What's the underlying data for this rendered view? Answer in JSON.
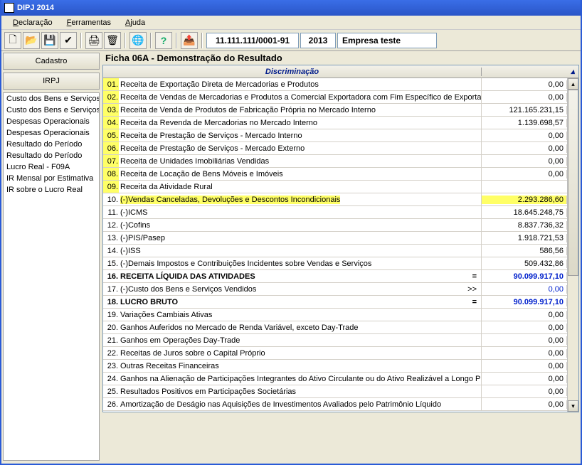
{
  "window": {
    "title": "DIPJ 2014"
  },
  "menu": {
    "declaracao": "Declaração",
    "ferramentas": "Ferramentas",
    "ajuda": "Ajuda"
  },
  "toolbar": {
    "icons": {
      "new": "new-icon",
      "open": "open-icon",
      "save": "save-icon",
      "check": "check-icon",
      "print": "print-icon",
      "trash": "trash-icon",
      "globe": "globe-icon",
      "help": "help-icon",
      "transmit": "transmit-icon"
    },
    "cnpj": "11.111.111/0001-91",
    "year": "2013",
    "company": "Empresa teste"
  },
  "sidebar": {
    "btn_cadastro": "Cadastro",
    "btn_irpj": "IRPJ",
    "items": [
      "Custo dos Bens e Serviços",
      "Custo dos Bens e Serviços",
      "Despesas Operacionais",
      "Despesas Operacionais",
      "Resultado do Período",
      "Resultado do Período",
      "Lucro Real - F09A",
      "IR Mensal por Estimativa",
      "IR sobre o Lucro Real"
    ]
  },
  "ficha": {
    "title": "Ficha 06A - Demonstração do Resultado",
    "header_col": "Discriminação",
    "rows": [
      {
        "num": "01.",
        "desc": "Receita de Exportação Direta de Mercadorias e Produtos",
        "val": "0,00",
        "hl": true
      },
      {
        "num": "02.",
        "desc": "Receita de Vendas de Mercadorias e Produtos a Comercial Exportadora com Fim Específico de Exportação",
        "val": "0,00",
        "hl": true
      },
      {
        "num": "03.",
        "desc": "Receita de Venda de Produtos de Fabricação Própria no Mercado Interno",
        "val": "121.165.231,15",
        "hl": true
      },
      {
        "num": "04.",
        "desc": "Receita da Revenda de Mercadorias no Mercado Interno",
        "val": "1.139.698,57",
        "hl": true
      },
      {
        "num": "05.",
        "desc": "Receita de Prestação de Serviços - Mercado Interno",
        "val": "0,00",
        "hl": true
      },
      {
        "num": "06.",
        "desc": "Receita de Prestação de Serviços - Mercado Externo",
        "val": "0,00",
        "hl": true
      },
      {
        "num": "07.",
        "desc": "Receita de Unidades Imobiliárias Vendidas",
        "val": "0,00",
        "hl": true
      },
      {
        "num": "08.",
        "desc": "Receita de Locação de Bens Móveis e Imóveis",
        "val": "0,00",
        "hl": true
      },
      {
        "num": "09.",
        "desc": "Receita da Atividade Rural",
        "val": "",
        "hl": true
      },
      {
        "num": "10.",
        "desc": "(-)Vendas Canceladas, Devoluções e Descontos Incondicionais",
        "val": "2.293.286,60",
        "hl": false,
        "hlfull": true
      },
      {
        "num": "11.",
        "desc": "(-)ICMS",
        "val": "18.645.248,75"
      },
      {
        "num": "12.",
        "desc": "(-)Cofins",
        "val": "8.837.736,32"
      },
      {
        "num": "13.",
        "desc": "(-)PIS/Pasep",
        "val": "1.918.721,53"
      },
      {
        "num": "14.",
        "desc": "(-)ISS",
        "val": "586,56"
      },
      {
        "num": "15.",
        "desc": "(-)Demais Impostos e Contribuições Incidentes sobre Vendas e Serviços",
        "val": "509.432,86"
      },
      {
        "num": "16.",
        "desc": "RECEITA LÍQUIDA DAS ATIVIDADES",
        "val": "90.099.917,10",
        "op": "=",
        "bold": true,
        "blue": true
      },
      {
        "num": "17.",
        "desc": "(-)Custo dos Bens e Serviços Vendidos",
        "val": "0,00",
        "op": ">>",
        "blue": true
      },
      {
        "num": "18.",
        "desc": "LUCRO BRUTO",
        "val": "90.099.917,10",
        "op": "=",
        "bold": true,
        "blue": true
      },
      {
        "num": "19.",
        "desc": "Variações Cambiais Ativas",
        "val": "0,00"
      },
      {
        "num": "20.",
        "desc": "Ganhos Auferidos no Mercado de Renda Variável, exceto Day-Trade",
        "val": "0,00"
      },
      {
        "num": "21.",
        "desc": "Ganhos em Operações Day-Trade",
        "val": "0,00"
      },
      {
        "num": "22.",
        "desc": "Receitas de Juros sobre o Capital Próprio",
        "val": "0,00"
      },
      {
        "num": "23.",
        "desc": "Outras Receitas Financeiras",
        "val": "0,00"
      },
      {
        "num": "24.",
        "desc": "Ganhos na Alienação de Participações Integrantes do Ativo Circulante ou do Ativo Realizável a Longo Prazo",
        "val": "0,00"
      },
      {
        "num": "25.",
        "desc": "Resultados Positivos em Participações Societárias",
        "val": "0,00"
      },
      {
        "num": "26.",
        "desc": "Amortização de Deságio nas Aquisições de Investimentos Avaliados pelo Patrimônio Líquido",
        "val": "0,00"
      }
    ]
  }
}
